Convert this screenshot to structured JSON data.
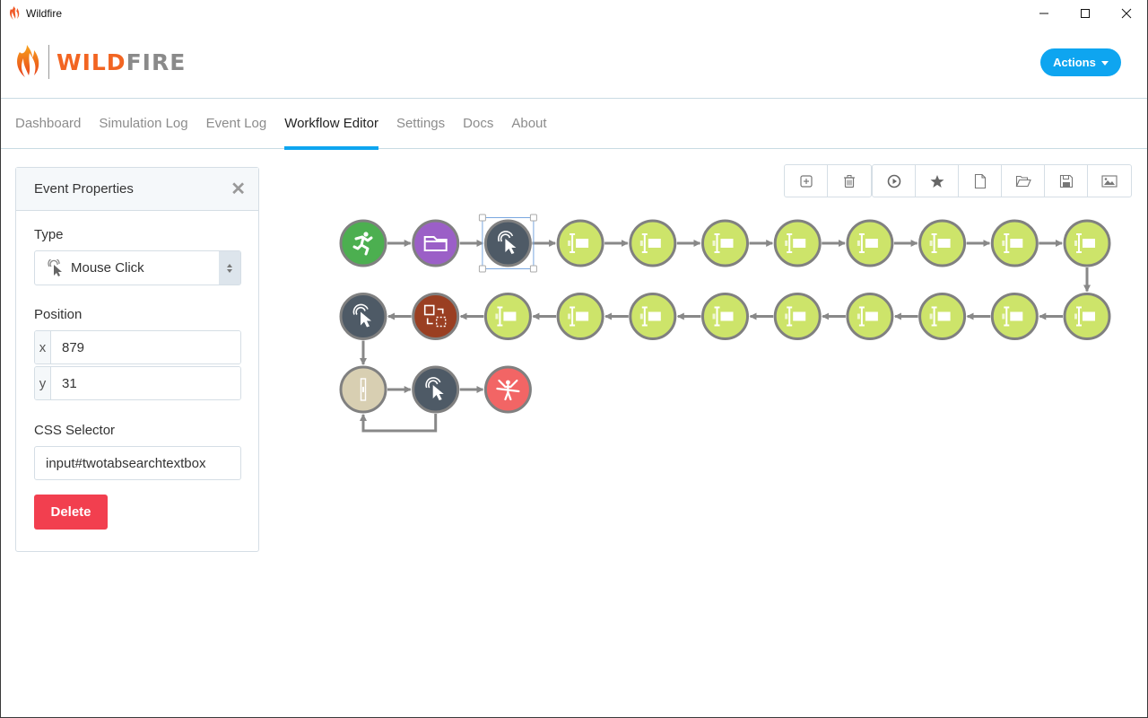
{
  "window": {
    "title": "Wildfire",
    "controls": [
      "minimize",
      "maximize",
      "close"
    ]
  },
  "header": {
    "logo_part1": "WILD",
    "logo_part2": "FIRE",
    "actions_label": "Actions"
  },
  "nav": {
    "tabs": [
      {
        "label": "Dashboard",
        "active": false
      },
      {
        "label": "Simulation Log",
        "active": false
      },
      {
        "label": "Event Log",
        "active": false
      },
      {
        "label": "Workflow Editor",
        "active": true
      },
      {
        "label": "Settings",
        "active": false
      },
      {
        "label": "Docs",
        "active": false
      },
      {
        "label": "About",
        "active": false
      }
    ]
  },
  "panel": {
    "title": "Event Properties",
    "close_icon": "close-icon",
    "type_label": "Type",
    "type_value": "Mouse Click",
    "type_icon": "mouse-click-icon",
    "position_label": "Position",
    "x_label": "x",
    "x_value": "879",
    "y_label": "y",
    "y_value": "31",
    "selector_label": "CSS Selector",
    "selector_value": "input#twotabsearchtextbox",
    "delete_label": "Delete"
  },
  "toolbar": {
    "group1": [
      {
        "icon": "add-node-icon",
        "name": "add-node-button"
      },
      {
        "icon": "trash-icon",
        "name": "delete-node-button"
      }
    ],
    "group2": [
      {
        "icon": "play-icon",
        "name": "run-button"
      },
      {
        "icon": "star-icon",
        "name": "favorite-button"
      },
      {
        "icon": "new-file-icon",
        "name": "new-file-button"
      },
      {
        "icon": "open-folder-icon",
        "name": "open-button"
      },
      {
        "icon": "save-icon",
        "name": "save-button"
      },
      {
        "icon": "image-icon",
        "name": "export-image-button"
      }
    ]
  },
  "colors": {
    "accent": "#0ea5f0",
    "danger": "#f23f4f",
    "start": "#4caf50",
    "open_url": "#9b5fc7",
    "mouse_click": "#4e5a66",
    "input": "#cde46a",
    "tab_change": "#9a3f22",
    "scroll": "#d8cfb2",
    "end": "#f26565",
    "edge": "#888888"
  },
  "workflow": {
    "selected_index": 2,
    "nodes": [
      {
        "type": "start",
        "icon": "start-runner-icon",
        "row": 0,
        "col": 0
      },
      {
        "type": "open_url",
        "icon": "open-tab-icon",
        "row": 0,
        "col": 1
      },
      {
        "type": "mouse_click",
        "icon": "mouse-click-icon",
        "row": 0,
        "col": 2
      },
      {
        "type": "input",
        "icon": "text-input-icon",
        "row": 0,
        "col": 3
      },
      {
        "type": "input",
        "icon": "text-input-icon",
        "row": 0,
        "col": 4
      },
      {
        "type": "input",
        "icon": "text-input-icon",
        "row": 0,
        "col": 5
      },
      {
        "type": "input",
        "icon": "text-input-icon",
        "row": 0,
        "col": 6
      },
      {
        "type": "input",
        "icon": "text-input-icon",
        "row": 0,
        "col": 7
      },
      {
        "type": "input",
        "icon": "text-input-icon",
        "row": 0,
        "col": 8
      },
      {
        "type": "input",
        "icon": "text-input-icon",
        "row": 0,
        "col": 9
      },
      {
        "type": "input",
        "icon": "text-input-icon",
        "row": 0,
        "col": 10
      },
      {
        "type": "input",
        "icon": "text-input-icon",
        "row": 1,
        "col": 10
      },
      {
        "type": "input",
        "icon": "text-input-icon",
        "row": 1,
        "col": 9
      },
      {
        "type": "input",
        "icon": "text-input-icon",
        "row": 1,
        "col": 8
      },
      {
        "type": "input",
        "icon": "text-input-icon",
        "row": 1,
        "col": 7
      },
      {
        "type": "input",
        "icon": "text-input-icon",
        "row": 1,
        "col": 6
      },
      {
        "type": "input",
        "icon": "text-input-icon",
        "row": 1,
        "col": 5
      },
      {
        "type": "input",
        "icon": "text-input-icon",
        "row": 1,
        "col": 4
      },
      {
        "type": "input",
        "icon": "text-input-icon",
        "row": 1,
        "col": 3
      },
      {
        "type": "input",
        "icon": "text-input-icon",
        "row": 1,
        "col": 2
      },
      {
        "type": "tab_change",
        "icon": "tab-change-icon",
        "row": 1,
        "col": 1
      },
      {
        "type": "mouse_click",
        "icon": "mouse-click-icon",
        "row": 1,
        "col": 0
      },
      {
        "type": "scroll",
        "icon": "scroll-icon",
        "row": 2,
        "col": 0
      },
      {
        "type": "mouse_click",
        "icon": "mouse-click-icon",
        "row": 2,
        "col": 1
      },
      {
        "type": "end",
        "icon": "finish-icon",
        "row": 2,
        "col": 2
      }
    ],
    "extra_edges": [
      {
        "from": 23,
        "to": 22,
        "style": "loop-under"
      }
    ]
  }
}
